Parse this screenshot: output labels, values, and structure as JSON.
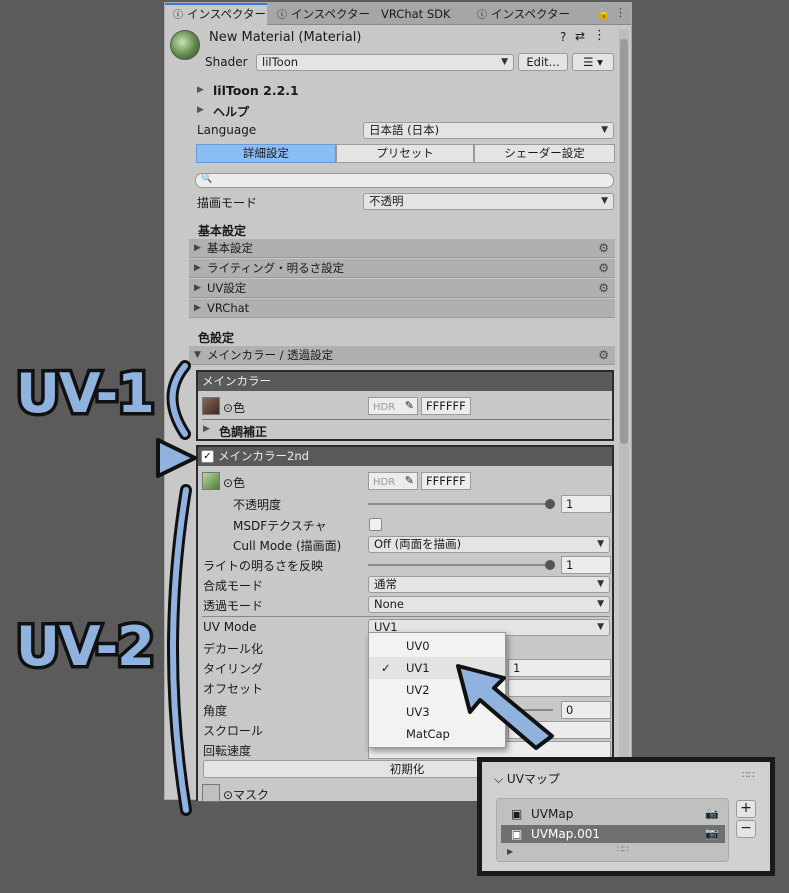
{
  "tabs": [
    {
      "label": "インスペクター"
    },
    {
      "label": "インスペクター"
    },
    {
      "label": "VRChat SDK"
    },
    {
      "label": "インスペクター"
    }
  ],
  "header": {
    "title": "New Material (Material)",
    "shader_label": "Shader",
    "shader_value": "lilToon",
    "edit_label": "Edit..."
  },
  "version": "lilToon 2.2.1",
  "help": "ヘルプ",
  "language": {
    "label": "Language",
    "value": "日本語 (日本)"
  },
  "modes": [
    {
      "label": "詳細設定",
      "active": true
    },
    {
      "label": "プリセット"
    },
    {
      "label": "シェーダー設定"
    }
  ],
  "render_mode": {
    "label": "描画モード",
    "value": "不透明"
  },
  "basic": {
    "heading": "基本設定",
    "sections": [
      "基本設定",
      "ライティング・明るさ設定",
      "UV設定",
      "VRChat"
    ]
  },
  "color": {
    "heading": "色設定",
    "section": "メインカラー / 透過設定"
  },
  "main": {
    "title": "メインカラー",
    "color_label": "⊙色",
    "hdr": "HDR",
    "hex": "FFFFFF",
    "adjust": "色調補正"
  },
  "main2": {
    "title": "メインカラー2nd",
    "color_label": "⊙色",
    "hdr": "HDR",
    "hex": "FFFFFF",
    "rows": {
      "opacity": "不透明度",
      "opacity_value": "1",
      "msdf": "MSDFテクスチャ",
      "cull": "Cull Mode (描画面)",
      "cull_value": "Off (両面を描画)",
      "light": "ライトの明るさを反映",
      "light_value": "1",
      "blend": "合成モード",
      "blend_value": "通常",
      "trans": "透過モード",
      "trans_value": "None",
      "uvmode": "UV Mode",
      "uvmode_value": "UV1",
      "decal": "デカール化",
      "tiling": "タイリング",
      "tiling_value": "1",
      "offset": "オフセット",
      "angle": "角度",
      "angle_value": "0",
      "scroll": "スクロール",
      "rot": "回転速度",
      "init": "初期化",
      "mask": "⊙マスク"
    }
  },
  "uv_options": [
    "UV0",
    "UV1",
    "UV2",
    "UV3",
    "MatCap"
  ],
  "uv_selected": "UV1",
  "annotations": {
    "uv1": "UV-1",
    "uv2": "UV-2"
  },
  "uvmap": {
    "title": "UVマップ",
    "items": [
      "UVMap",
      "UVMap.001"
    ],
    "add": "+",
    "remove": "−"
  },
  "colors": {
    "accent": "#8bbdf5",
    "annotation": "#8fb2df"
  }
}
